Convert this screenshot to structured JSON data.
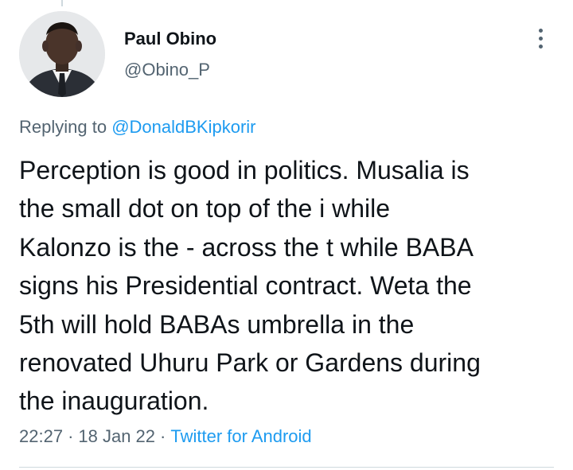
{
  "author": {
    "name": "Paul Obino",
    "handle": "@Obino_P"
  },
  "reply": {
    "prefix": "Replying to",
    "mention": "@DonaldBKipkorir"
  },
  "tweet": {
    "text_lines": [
      "Perception is good in politics. Musalia is",
      "the small dot on top of the i while",
      "Kalonzo is the - across the t while BABA",
      "signs his Presidential contract. Weta the",
      "5th will hold BABAs umbrella in the",
      "renovated Uhuru Park or Gardens during",
      "the inauguration."
    ]
  },
  "meta": {
    "time": "22:27",
    "date": "18 Jan 22",
    "separator": "·",
    "source": "Twitter for Android"
  },
  "icons": {
    "more": "more-vertical-icon"
  },
  "colors": {
    "text": "#0f1419",
    "secondary": "#536471",
    "link": "#1d9bf0",
    "divider": "#cfd9de"
  }
}
